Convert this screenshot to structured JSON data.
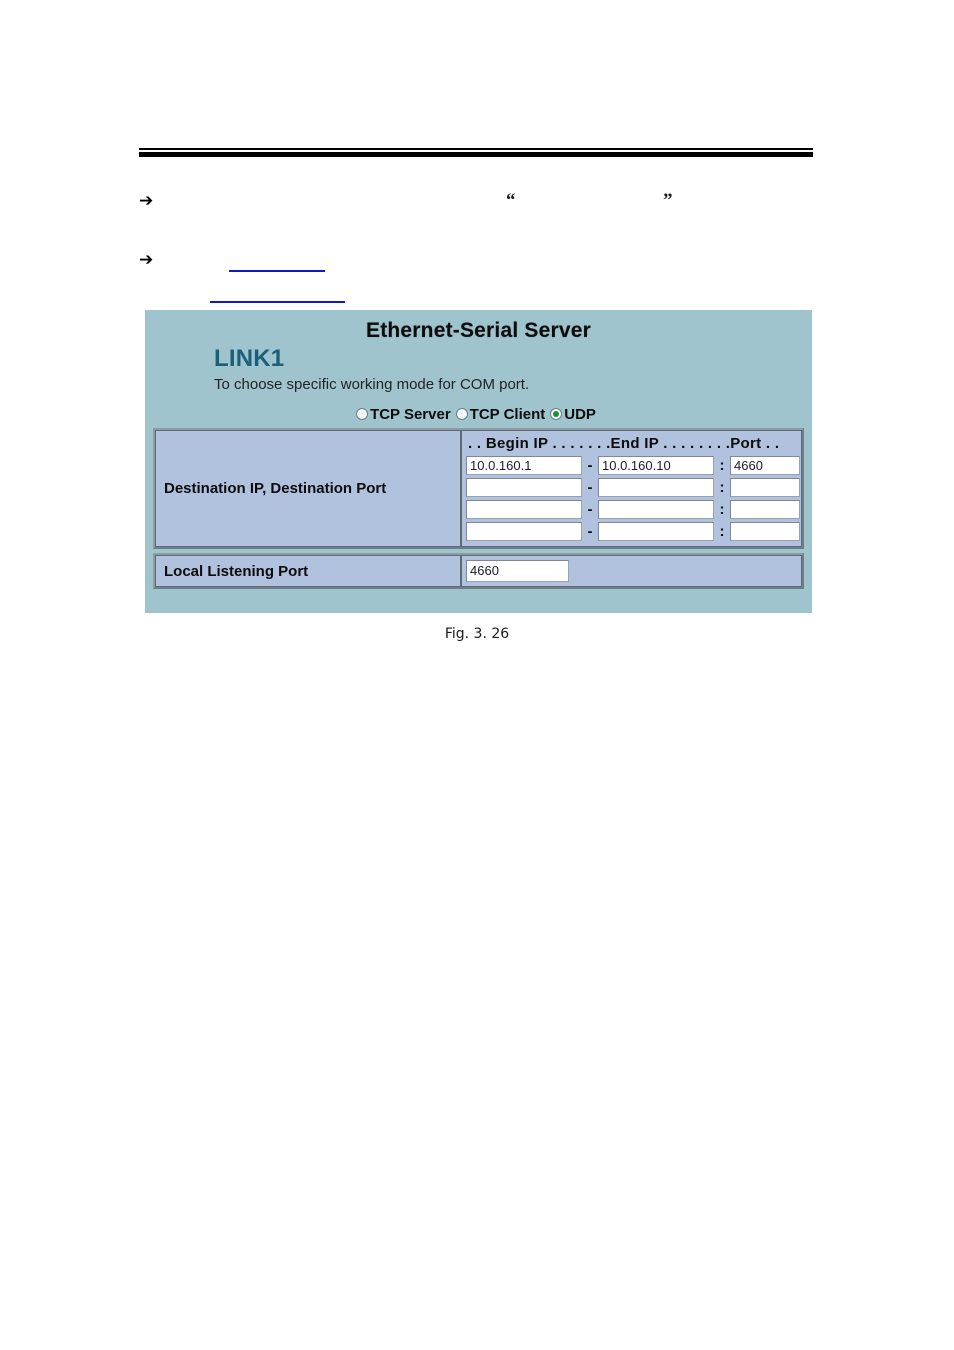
{
  "document": {
    "bullets": [
      {
        "arrow": "➔",
        "text": ""
      },
      {
        "arrow": "➔",
        "text": ""
      }
    ],
    "quote_open": "“",
    "quote_close": "”",
    "links": [
      {
        "text": ""
      },
      {
        "text": ""
      }
    ],
    "figure_caption": "Fig. 3. 26"
  },
  "panel": {
    "title": "Ethernet-Serial Server",
    "link_name": "LINK1",
    "description": "To choose specific working mode for COM port.",
    "colors": {
      "panel_background": "#a0c4ce",
      "table_background": "#b0c2dd",
      "link_name_color": "#1c5f78",
      "radio_selected_color": "#0f9a2e",
      "link_underline_color": "#1515c8"
    },
    "working_modes": {
      "options": [
        {
          "label": "TCP Server",
          "selected": false
        },
        {
          "label": "TCP Client",
          "selected": false
        },
        {
          "label": "UDP",
          "selected": true
        }
      ],
      "selected_value": "UDP"
    },
    "destination_table": {
      "row_label": "Destination IP, Destination Port",
      "column_header": ". . Begin IP . . . . . . .End IP . . . . . . . .Port . .",
      "separator_dash": "-",
      "separator_colon": ":",
      "rows": [
        {
          "begin_ip": "10.0.160.1",
          "end_ip": "10.0.160.10",
          "port": "4660"
        },
        {
          "begin_ip": "",
          "end_ip": "",
          "port": ""
        },
        {
          "begin_ip": "",
          "end_ip": "",
          "port": ""
        },
        {
          "begin_ip": "",
          "end_ip": "",
          "port": ""
        }
      ]
    },
    "local_table": {
      "row_label": "Local Listening Port",
      "value": "4660"
    }
  }
}
